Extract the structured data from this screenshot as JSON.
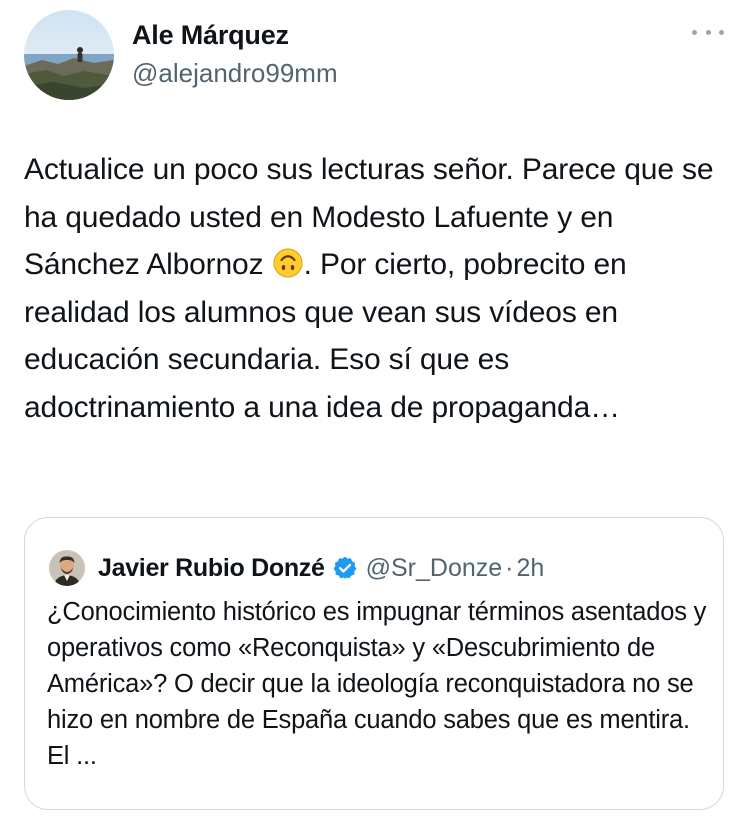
{
  "tweet": {
    "author_name": "Ale Márquez",
    "author_handle": "@alejandro99mm",
    "more_icon": "more-horizontal-icon",
    "text_part1": "Actualice un poco sus lecturas señor. Parece que se ha quedado usted en Modesto Lafuente y en Sánchez Albornoz",
    "emoji": "upside-down-face",
    "text_part2": ". Por cierto, pobrecito en realidad los alumnos que vean sus vídeos en educación secundaria. Eso sí que es adoctrinamiento a una idea de propaganda…"
  },
  "quote": {
    "author_name": "Javier Rubio Donzé",
    "verified_icon": "verified-badge-icon",
    "author_handle": "@Sr_Donze",
    "separator": "·",
    "time": "2h",
    "text": "¿Conocimiento histórico es impugnar términos asentados y operativos como «Reconquista» y «Descubrimiento de América»? O decir que la ideología reconquistadora no se hizo en nombre de España cuando sabes que es mentira. El ..."
  },
  "colors": {
    "text_primary": "#0f1419",
    "text_secondary": "#536471",
    "border": "#cfd9de",
    "verified_blue": "#1d9bf0"
  }
}
